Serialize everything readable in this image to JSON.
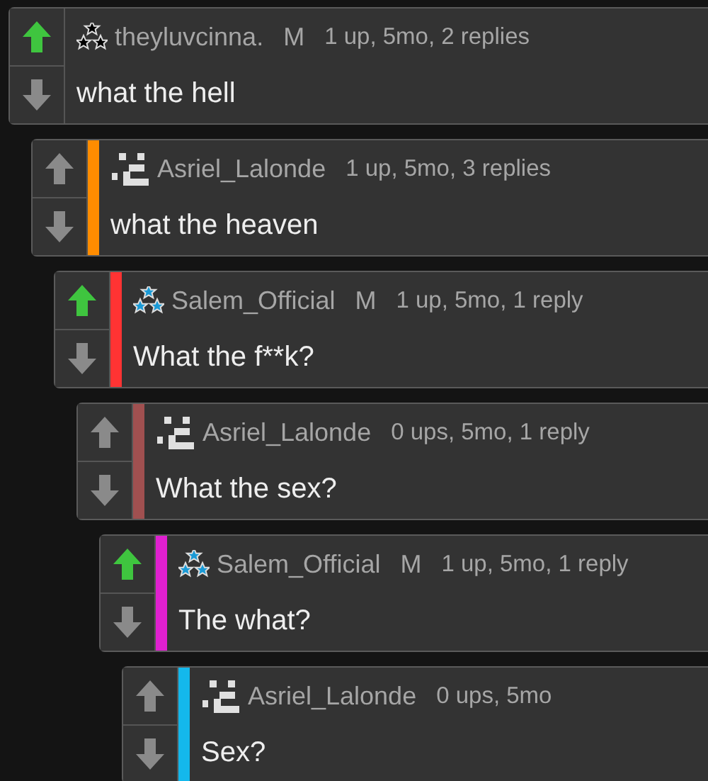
{
  "comments": [
    {
      "avatar": {
        "kind": "stars",
        "color": "#000000"
      },
      "username": "theyluvcinna.",
      "badge": "M",
      "meta": "1 up, 5mo, 2 replies",
      "text": "what the hell",
      "upvoted": true,
      "children": [
        {
          "avatar": {
            "kind": "pixel"
          },
          "username": "Asriel_Lalonde",
          "meta": "1 up, 5mo, 3 replies",
          "text": "what the heaven",
          "upvoted": false,
          "color": "#ff8c00",
          "children": [
            {
              "avatar": {
                "kind": "stars",
                "color": "#1a9ad6"
              },
              "username": "Salem_Official",
              "badge": "M",
              "meta": "1 up, 5mo, 1 reply",
              "text": "What the f**k?",
              "upvoted": true,
              "color": "#ff3333",
              "children": [
                {
                  "avatar": {
                    "kind": "pixel"
                  },
                  "username": "Asriel_Lalonde",
                  "meta": "0 ups, 5mo, 1 reply",
                  "text": "What the sex?",
                  "upvoted": false,
                  "color": "#a05050",
                  "children": [
                    {
                      "avatar": {
                        "kind": "stars",
                        "color": "#1a9ad6"
                      },
                      "username": "Salem_Official",
                      "badge": "M",
                      "meta": "1 up, 5mo, 1 reply",
                      "text": "The what?",
                      "upvoted": true,
                      "color": "#e020d0",
                      "children": [
                        {
                          "avatar": {
                            "kind": "pixel"
                          },
                          "username": "Asriel_Lalonde",
                          "meta": "0 ups, 5mo",
                          "text": "Sex?",
                          "upvoted": false,
                          "color": "#14b8ec"
                        }
                      ]
                    }
                  ]
                }
              ]
            }
          ]
        }
      ]
    }
  ]
}
